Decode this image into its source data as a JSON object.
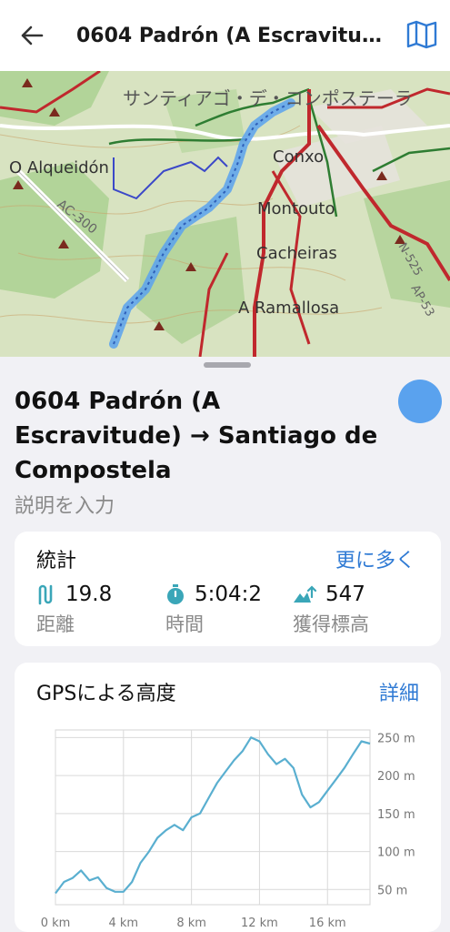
{
  "header": {
    "title": "0604 Padrón (A Escravitude) → Santiago de Compostela"
  },
  "map": {
    "labels": {
      "city": "サンティアゴ・デ・コンポステーラ",
      "alqueidon": "O Alqueidón",
      "conxo": "Conxo",
      "montouto": "Montouto",
      "cacheiras": "Cacheiras",
      "ramallosa": "A Ramallosa",
      "ac300": "AC-300",
      "n525": "N-525",
      "ap53": "AP-53"
    }
  },
  "track": {
    "name": "0604 Padrón (A Escravitude) → Santiago de Compostela",
    "description_placeholder": "説明を入力",
    "color": "#5aa2ee"
  },
  "stats": {
    "title": "統計",
    "more_label": "更に多く",
    "distance": {
      "value": "19.8",
      "label": "距離"
    },
    "time": {
      "value": "5:04:2",
      "label": "時間"
    },
    "gain": {
      "value": "547",
      "label": "獲得標高"
    }
  },
  "elevation": {
    "title": "GPSによる高度",
    "details_label": "詳細"
  },
  "chart_data": {
    "type": "line",
    "title": "GPSによる高度",
    "xlabel": "",
    "ylabel": "",
    "x_ticks": [
      "0 km",
      "4 km",
      "8 km",
      "12 km",
      "16 km"
    ],
    "y_ticks": [
      "50 m",
      "100 m",
      "150 m",
      "200 m",
      "250 m"
    ],
    "xlim": [
      0,
      18.5
    ],
    "ylim": [
      30,
      260
    ],
    "grid": true,
    "line_color": "#5aafd0",
    "x": [
      0,
      0.5,
      1,
      1.5,
      2,
      2.5,
      3,
      3.5,
      4,
      4.5,
      5,
      5.5,
      6,
      6.5,
      7,
      7.5,
      8,
      8.5,
      9,
      9.5,
      10,
      10.5,
      11,
      11.5,
      12,
      12.5,
      13,
      13.5,
      14,
      14.5,
      15,
      15.5,
      16,
      16.5,
      17,
      17.5,
      18,
      18.5
    ],
    "y": [
      45,
      60,
      65,
      75,
      62,
      66,
      52,
      47,
      47,
      60,
      85,
      100,
      118,
      128,
      135,
      128,
      145,
      150,
      170,
      190,
      205,
      220,
      232,
      250,
      245,
      228,
      215,
      222,
      210,
      175,
      158,
      165,
      180,
      195,
      210,
      228,
      245,
      242
    ]
  }
}
